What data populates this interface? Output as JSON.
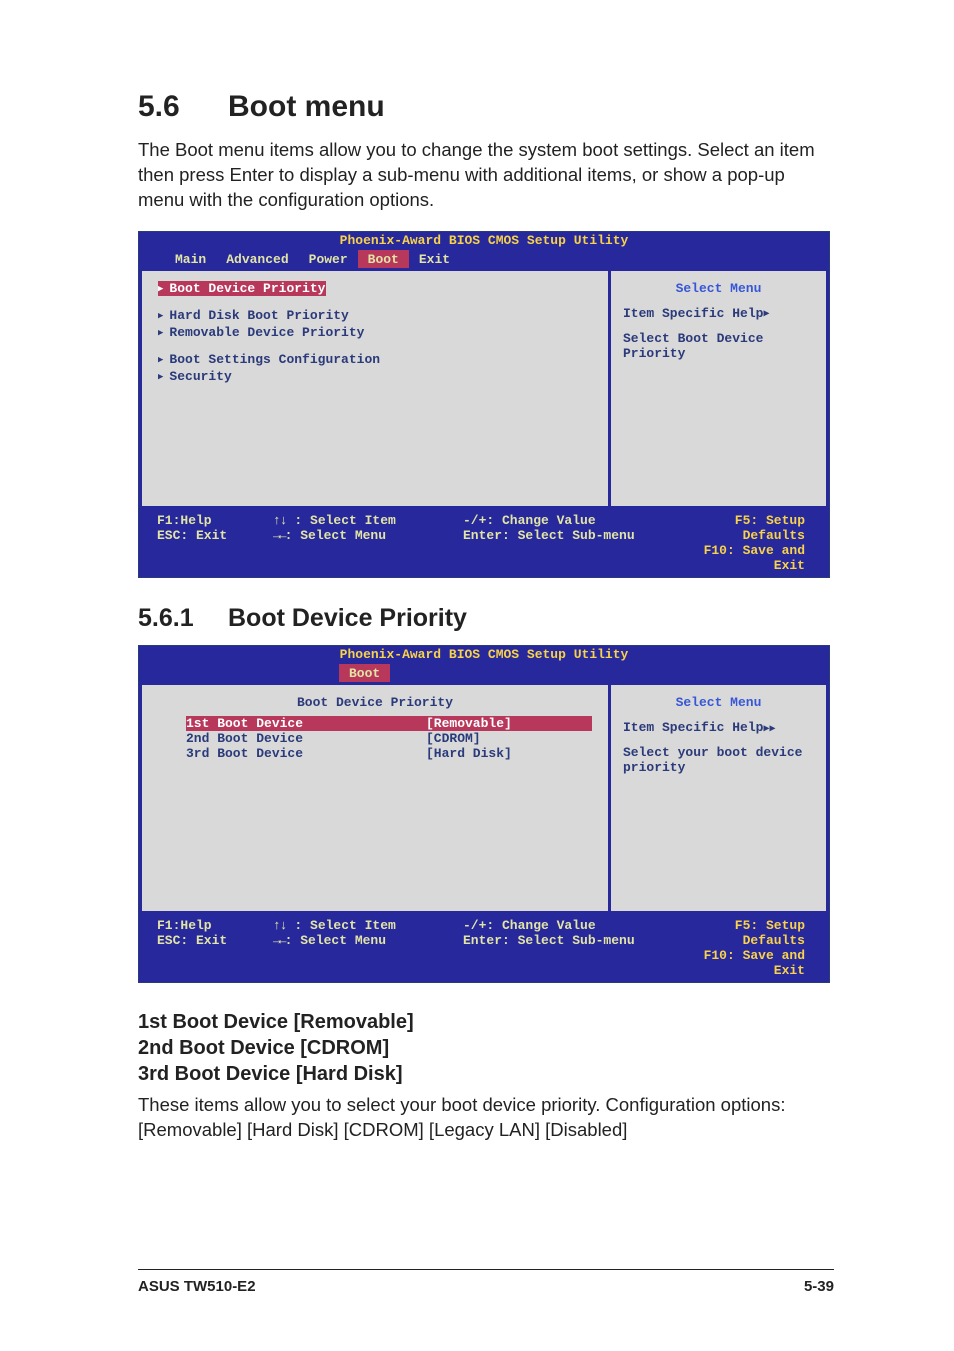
{
  "heading": {
    "num": "5.6",
    "title": "Boot menu"
  },
  "intro": "The Boot menu items allow you to change the system boot settings. Select an item then press Enter to display a sub-menu with additional items, or show a pop-up menu with the configuration options.",
  "bios1": {
    "title": "Phoenix-Award BIOS CMOS Setup Utility",
    "tabs": {
      "main": "Main",
      "advanced": "Advanced",
      "power": "Power",
      "boot": "Boot",
      "exit": "Exit"
    },
    "items": {
      "boot_device_priority": "Boot Device Priority",
      "hard_disk_boot_priority": "Hard Disk Boot Priority",
      "removable_device_priority": "Removable Device Priority",
      "boot_settings_configuration": "Boot Settings Configuration",
      "security": "Security"
    },
    "right": {
      "select_menu": "Select Menu",
      "help_label": "Item Specific Help",
      "help_text1": "Select Boot Device",
      "help_text2": "Priority"
    },
    "legend": {
      "f1": "F1:Help",
      "esc": "ESC: Exit",
      "sel_item": ": Select Item",
      "sel_menu": ": Select Menu",
      "change": "-/+: Change Value",
      "enter": "Enter: Select Sub-menu",
      "f5": "F5: Setup Defaults",
      "f10": "F10: Save and Exit"
    }
  },
  "sub": {
    "num": "5.6.1",
    "title": "Boot Device Priority"
  },
  "bios2": {
    "title": "Phoenix-Award BIOS CMOS Setup Utility",
    "tab_boot": "Boot",
    "sub_title": "Boot Device Priority",
    "rows": {
      "first_label": "1st Boot Device",
      "first_value": "[Removable]",
      "second_label": "2nd Boot Device",
      "second_value": "[CDROM]",
      "third_label": "3rd Boot Device",
      "third_value": "[Hard Disk]"
    },
    "right": {
      "select_menu": "Select Menu",
      "help_label": "Item Specific Help",
      "help_text1": "Select your boot device",
      "help_text2": "priority"
    },
    "legend": {
      "f1": "F1:Help",
      "esc": "ESC: Exit",
      "sel_item": ": Select Item",
      "sel_menu": ": Select Menu",
      "change": "-/+: Change Value",
      "enter": "Enter: Select Sub-menu",
      "f5": "F5: Setup Defaults",
      "f10": "F10: Save and Exit"
    }
  },
  "devhead": {
    "line1": "1st Boot Device [Removable]",
    "line2": "2nd Boot Device [CDROM]",
    "line3": "3rd Boot Device [Hard Disk]"
  },
  "devtext": "These items allow you to select your boot device priority. Configuration options: [Removable] [Hard Disk] [CDROM] [Legacy LAN] [Disabled]",
  "footer": {
    "left": "ASUS TW510-E2",
    "right": "5-39"
  },
  "chart_data": {
    "type": "table",
    "title": "Boot Device Priority",
    "rows": [
      {
        "slot": "1st Boot Device",
        "value": "Removable"
      },
      {
        "slot": "2nd Boot Device",
        "value": "CDROM"
      },
      {
        "slot": "3rd Boot Device",
        "value": "Hard Disk"
      }
    ],
    "options": [
      "Removable",
      "Hard Disk",
      "CDROM",
      "Legacy LAN",
      "Disabled"
    ]
  }
}
